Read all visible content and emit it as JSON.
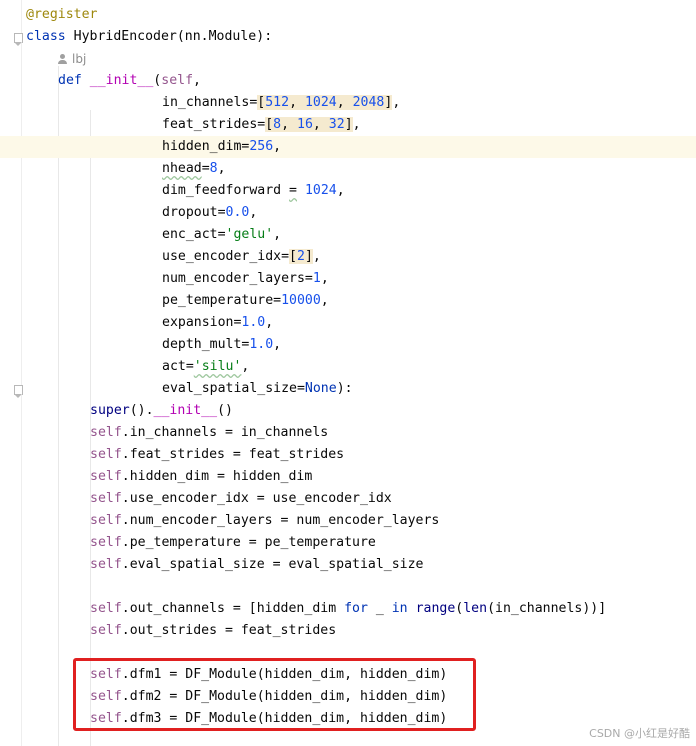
{
  "editor": {
    "lines": [
      {
        "indent": 26,
        "tokens": [
          {
            "t": "@register",
            "c": "deco"
          }
        ]
      },
      {
        "indent": 26,
        "fold": true,
        "tokens": [
          {
            "t": "class ",
            "c": "kw"
          },
          {
            "t": "HybridEncoder(nn.Module):"
          }
        ]
      },
      {
        "indent": 58,
        "inlay": "lbj"
      },
      {
        "indent": 58,
        "tokens": [
          {
            "t": "def ",
            "c": "kw"
          },
          {
            "t": "__init__",
            "c": "dunder"
          },
          {
            "t": "("
          },
          {
            "t": "self",
            "c": "slf"
          },
          {
            "t": ","
          }
        ]
      },
      {
        "indent": 162,
        "tokens": [
          {
            "t": "in_channels="
          },
          {
            "t": "[",
            "c": "hl"
          },
          {
            "t": "512",
            "c": "num hl"
          },
          {
            "t": ", ",
            "c": "hl"
          },
          {
            "t": "1024",
            "c": "num hl"
          },
          {
            "t": ", ",
            "c": "hl"
          },
          {
            "t": "2048",
            "c": "num hl"
          },
          {
            "t": "]",
            "c": "hl"
          },
          {
            "t": ","
          }
        ]
      },
      {
        "indent": 162,
        "tokens": [
          {
            "t": "feat_strides="
          },
          {
            "t": "[",
            "c": "hl"
          },
          {
            "t": "8",
            "c": "num hl"
          },
          {
            "t": ", ",
            "c": "hl"
          },
          {
            "t": "16",
            "c": "num hl"
          },
          {
            "t": ", ",
            "c": "hl"
          },
          {
            "t": "32",
            "c": "num hl"
          },
          {
            "t": "]",
            "c": "hl"
          },
          {
            "t": ","
          }
        ]
      },
      {
        "indent": 162,
        "current": true,
        "tokens": [
          {
            "t": "hidden_dim="
          },
          {
            "t": "256",
            "c": "num"
          },
          {
            "t": ","
          }
        ]
      },
      {
        "indent": 162,
        "tokens": [
          {
            "t": "nhead",
            "c": "warn"
          },
          {
            "t": "="
          },
          {
            "t": "8",
            "c": "num"
          },
          {
            "t": ","
          }
        ]
      },
      {
        "indent": 162,
        "tokens": [
          {
            "t": "dim_feedforward "
          },
          {
            "t": "=",
            "c": "warn"
          },
          {
            "t": " "
          },
          {
            "t": "1024",
            "c": "num"
          },
          {
            "t": ","
          }
        ]
      },
      {
        "indent": 162,
        "tokens": [
          {
            "t": "dropout="
          },
          {
            "t": "0.0",
            "c": "num"
          },
          {
            "t": ","
          }
        ]
      },
      {
        "indent": 162,
        "tokens": [
          {
            "t": "enc_act="
          },
          {
            "t": "'gelu'",
            "c": "str"
          },
          {
            "t": ","
          }
        ]
      },
      {
        "indent": 162,
        "tokens": [
          {
            "t": "use_encoder_idx="
          },
          {
            "t": "[",
            "c": "hl"
          },
          {
            "t": "2",
            "c": "num hl"
          },
          {
            "t": "]",
            "c": "hl"
          },
          {
            "t": ","
          }
        ]
      },
      {
        "indent": 162,
        "tokens": [
          {
            "t": "num_encoder_layers="
          },
          {
            "t": "1",
            "c": "num"
          },
          {
            "t": ","
          }
        ]
      },
      {
        "indent": 162,
        "tokens": [
          {
            "t": "pe_temperature="
          },
          {
            "t": "10000",
            "c": "num"
          },
          {
            "t": ","
          }
        ]
      },
      {
        "indent": 162,
        "tokens": [
          {
            "t": "expansion="
          },
          {
            "t": "1.0",
            "c": "num"
          },
          {
            "t": ","
          }
        ]
      },
      {
        "indent": 162,
        "tokens": [
          {
            "t": "depth_mult="
          },
          {
            "t": "1.0",
            "c": "num"
          },
          {
            "t": ","
          }
        ]
      },
      {
        "indent": 162,
        "tokens": [
          {
            "t": "act="
          },
          {
            "t": "'silu'",
            "c": "str warn"
          },
          {
            "t": ","
          }
        ]
      },
      {
        "indent": 162,
        "fold": true,
        "tokens": [
          {
            "t": "eval_spatial_size="
          },
          {
            "t": "None",
            "c": "kw"
          },
          {
            "t": "):"
          }
        ]
      },
      {
        "indent": 90,
        "tokens": [
          {
            "t": "super",
            "c": "builtin"
          },
          {
            "t": "()."
          },
          {
            "t": "__init__",
            "c": "dunder"
          },
          {
            "t": "()"
          }
        ]
      },
      {
        "indent": 90,
        "tokens": [
          {
            "t": "self",
            "c": "slf"
          },
          {
            "t": ".in_channels = in_channels"
          }
        ]
      },
      {
        "indent": 90,
        "tokens": [
          {
            "t": "self",
            "c": "slf"
          },
          {
            "t": ".feat_strides = feat_strides"
          }
        ]
      },
      {
        "indent": 90,
        "tokens": [
          {
            "t": "self",
            "c": "slf"
          },
          {
            "t": ".hidden_dim = hidden_dim"
          }
        ]
      },
      {
        "indent": 90,
        "tokens": [
          {
            "t": "self",
            "c": "slf"
          },
          {
            "t": ".use_encoder_idx = use_encoder_idx"
          }
        ]
      },
      {
        "indent": 90,
        "tokens": [
          {
            "t": "self",
            "c": "slf"
          },
          {
            "t": ".num_encoder_layers = num_encoder_layers"
          }
        ]
      },
      {
        "indent": 90,
        "tokens": [
          {
            "t": "self",
            "c": "slf"
          },
          {
            "t": ".pe_temperature = pe_temperature"
          }
        ]
      },
      {
        "indent": 90,
        "tokens": [
          {
            "t": "self",
            "c": "slf"
          },
          {
            "t": ".eval_spatial_size = eval_spatial_size"
          }
        ]
      },
      {
        "indent": 90,
        "tokens": []
      },
      {
        "indent": 90,
        "tokens": [
          {
            "t": "self",
            "c": "slf"
          },
          {
            "t": ".out_channels = [hidden_dim "
          },
          {
            "t": "for",
            "c": "kw"
          },
          {
            "t": " _ "
          },
          {
            "t": "in",
            "c": "kw"
          },
          {
            "t": " "
          },
          {
            "t": "range",
            "c": "builtin"
          },
          {
            "t": "("
          },
          {
            "t": "len",
            "c": "builtin"
          },
          {
            "t": "(in_channels))]"
          }
        ]
      },
      {
        "indent": 90,
        "tokens": [
          {
            "t": "self",
            "c": "slf"
          },
          {
            "t": ".out_strides = feat_strides"
          }
        ]
      },
      {
        "indent": 90,
        "tokens": []
      },
      {
        "indent": 90,
        "tokens": [
          {
            "t": "self",
            "c": "slf"
          },
          {
            "t": ".dfm1 = DF_Module(hidden_dim, hidden_dim)"
          }
        ]
      },
      {
        "indent": 90,
        "tokens": [
          {
            "t": "self",
            "c": "slf"
          },
          {
            "t": ".dfm2 = DF_Module(hidden_dim, hidden_dim)"
          }
        ]
      },
      {
        "indent": 90,
        "tokens": [
          {
            "t": "self",
            "c": "slf"
          },
          {
            "t": ".dfm3 = DF_Module(hidden_dim, hidden_dim)"
          }
        ]
      }
    ]
  },
  "watermark": "CSDN @小红是好酷"
}
